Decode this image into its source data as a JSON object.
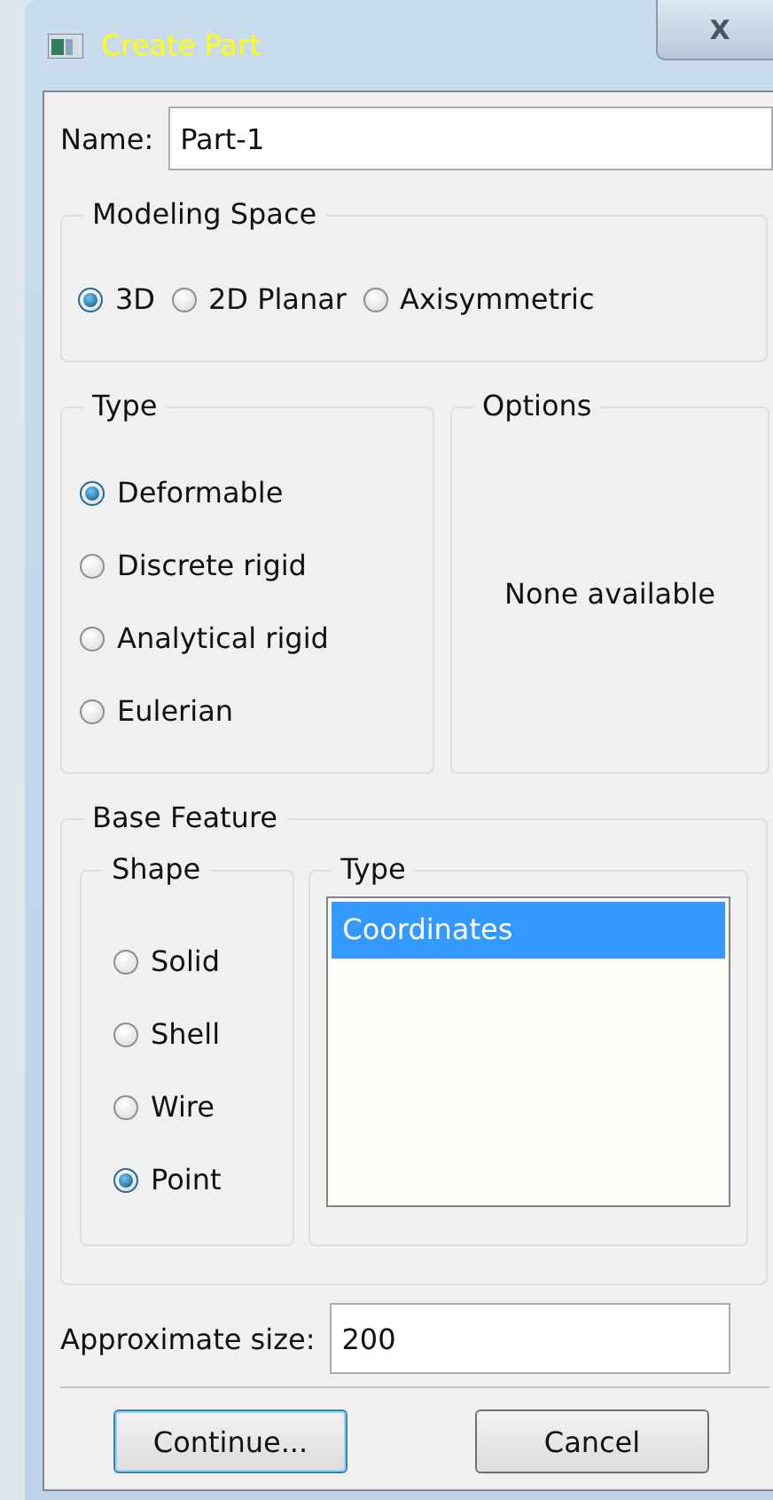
{
  "window": {
    "title": "Create Part",
    "close_label": "X"
  },
  "name_field": {
    "label": "Name:",
    "value": "Part-1"
  },
  "modeling_space": {
    "title": "Modeling Space",
    "options": [
      {
        "label": "3D",
        "selected": true
      },
      {
        "label": "2D Planar",
        "selected": false
      },
      {
        "label": "Axisymmetric",
        "selected": false
      }
    ]
  },
  "type": {
    "title": "Type",
    "options": [
      {
        "label": "Deformable",
        "selected": true
      },
      {
        "label": "Discrete rigid",
        "selected": false
      },
      {
        "label": "Analytical rigid",
        "selected": false
      },
      {
        "label": "Eulerian",
        "selected": false
      }
    ]
  },
  "options": {
    "title": "Options",
    "message": "None available"
  },
  "base_feature": {
    "title": "Base Feature",
    "shape": {
      "title": "Shape",
      "options": [
        {
          "label": "Solid",
          "selected": false
        },
        {
          "label": "Shell",
          "selected": false
        },
        {
          "label": "Wire",
          "selected": false
        },
        {
          "label": "Point",
          "selected": true
        }
      ]
    },
    "type": {
      "title": "Type",
      "items": [
        {
          "label": "Coordinates",
          "selected": true
        }
      ]
    }
  },
  "approximate_size": {
    "label": "Approximate size:",
    "value": "200"
  },
  "buttons": [
    {
      "label": "Continue...",
      "kind": "default"
    },
    {
      "label": "Cancel",
      "kind": "normal"
    }
  ]
}
